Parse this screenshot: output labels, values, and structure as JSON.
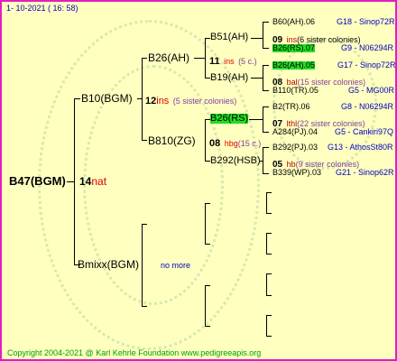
{
  "date": "1- 10-2021 ( 16: 58)",
  "copyright": "Copyright 2004-2021 @ Karl Kehrle Foundation   www.pedigreeapis.org",
  "root": {
    "name": "B47(BGM)",
    "generation": "14",
    "origin": "nat"
  },
  "gen1": [
    {
      "name": "B10(BGM)",
      "generation": "12",
      "origin": "ins",
      "sisters": "(5 sister colonies)"
    },
    {
      "name": "Bmixx(BGM)",
      "note": "no more"
    }
  ],
  "gen2": [
    {
      "name": "B26(AH)",
      "generation": "11",
      "origin": "ins",
      "sisters": "(5 c.)"
    },
    {
      "name": "B810(ZG)",
      "generation": "08",
      "origin": "hbg",
      "sisters": "(15 c.)"
    }
  ],
  "gen3": [
    {
      "name": "B51(AH)"
    },
    {
      "name": "B19(AH)"
    },
    {
      "name": "B26(RS)"
    },
    {
      "name": "B292(HSB)"
    }
  ],
  "gen4": [
    {
      "name": "B60(AH).06",
      "ref": "G18 - Sinop72R"
    },
    {
      "generation": "09",
      "origin": "ins",
      "sisters": "(6 sister colonies)"
    },
    {
      "name": "B26(RS).07",
      "ref": "G9 - N06294R"
    },
    {
      "name": "B26(AH).05",
      "ref": "G17 - Sinop72R"
    },
    {
      "generation": "08",
      "origin": "bal",
      "sisters": "(15 sister colonies)"
    },
    {
      "name": "B110(TR).05",
      "ref": "G5 - MG00R"
    },
    {
      "name": "B2(TR).06",
      "ref": "G8 - N06294R"
    },
    {
      "generation": "07",
      "origin": "lthl",
      "sisters": "(22 sister colonies)"
    },
    {
      "name": "A284(PJ).04",
      "ref": "G5 - Cankiri97Q"
    },
    {
      "name": "B292(PJ).03",
      "ref": "G13 - AthosSt80R"
    },
    {
      "generation": "05",
      "origin": "hb",
      "sisters": "(9 sister colonies)"
    },
    {
      "name": "B339(WP).03",
      "ref": "G21 - Sinop62R"
    }
  ],
  "colors": {
    "frame": "#e020c0",
    "background": "#ffffc0",
    "highlight": "#22dd22",
    "red": "#e00000",
    "blue": "#0000c0",
    "copyright": "#00a000"
  }
}
